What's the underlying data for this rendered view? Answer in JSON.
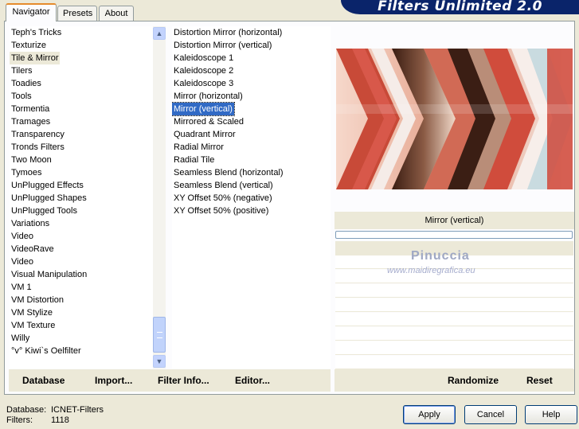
{
  "tabs": [
    "Navigator",
    "Presets",
    "About"
  ],
  "banner": "Filters Unlimited 2.0",
  "categories": [
    "Teph's Tricks",
    "Texturize",
    "Tile & Mirror",
    "Tilers",
    "Toadies",
    "Tools",
    "Tormentia",
    "Tramages",
    "Transparency",
    "Tronds Filters",
    "Two Moon",
    "Tymoes",
    "UnPlugged Effects",
    "UnPlugged Shapes",
    "UnPlugged Tools",
    "Variations",
    "Video",
    "VideoRave",
    "Video",
    "Visual Manipulation",
    "VM 1",
    "VM Distortion",
    "VM Stylize",
    "VM Texture",
    "Willy",
    "°v° Kiwi`s Oelfilter"
  ],
  "selected_category": "Tile & Mirror",
  "filters": [
    "Distortion Mirror (horizontal)",
    "Distortion Mirror (vertical)",
    "Kaleidoscope 1",
    "Kaleidoscope 2",
    "Kaleidoscope 3",
    "Mirror (horizontal)",
    "Mirror (vertical)",
    "Mirrored & Scaled",
    "Quadrant Mirror",
    "Radial Mirror",
    "Radial Tile",
    "Seamless Blend (horizontal)",
    "Seamless Blend (vertical)",
    "XY Offset 50% (negative)",
    "XY Offset 50% (positive)"
  ],
  "selected_filter": "Mirror (vertical)",
  "preview_caption": "Mirror (vertical)",
  "watermark": {
    "name": "Pinuccia",
    "site": "www.maidiregrafica.eu"
  },
  "actions": {
    "database": "Database",
    "import": "Import...",
    "filter_info": "Filter Info...",
    "editor": "Editor...",
    "randomize": "Randomize",
    "reset": "Reset"
  },
  "status": {
    "database_label": "Database:",
    "database_value": "ICNET-Filters",
    "filters_label": "Filters:",
    "filters_value": "1118"
  },
  "buttons": {
    "apply": "Apply",
    "cancel": "Cancel",
    "help": "Help"
  }
}
